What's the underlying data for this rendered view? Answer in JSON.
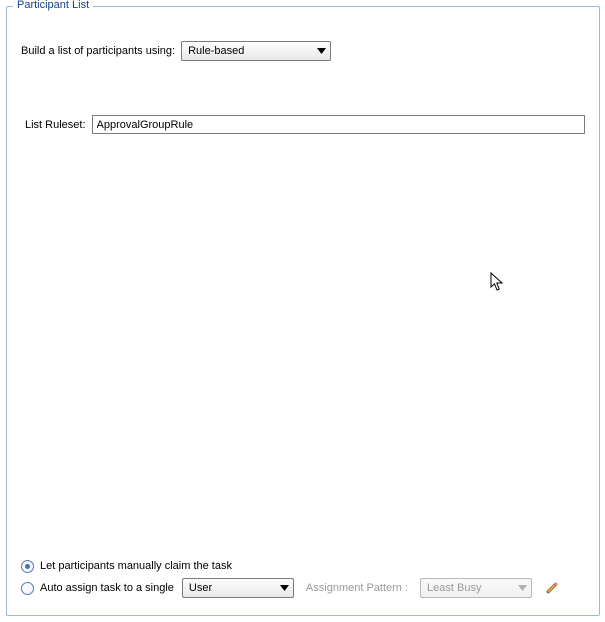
{
  "panel": {
    "legend": "Participant List"
  },
  "build": {
    "label": "Build a list of participants using:",
    "selected": "Rule-based"
  },
  "ruleset": {
    "label": "List Ruleset:",
    "value": "ApprovalGroupRule"
  },
  "assignment": {
    "radio_manual_label": "Let participants manually claim the task",
    "radio_auto_label": "Auto assign task to a single",
    "auto_target_selected": "User",
    "pattern_label": "Assignment Pattern :",
    "pattern_selected": "Least Busy",
    "selected": "manual"
  }
}
